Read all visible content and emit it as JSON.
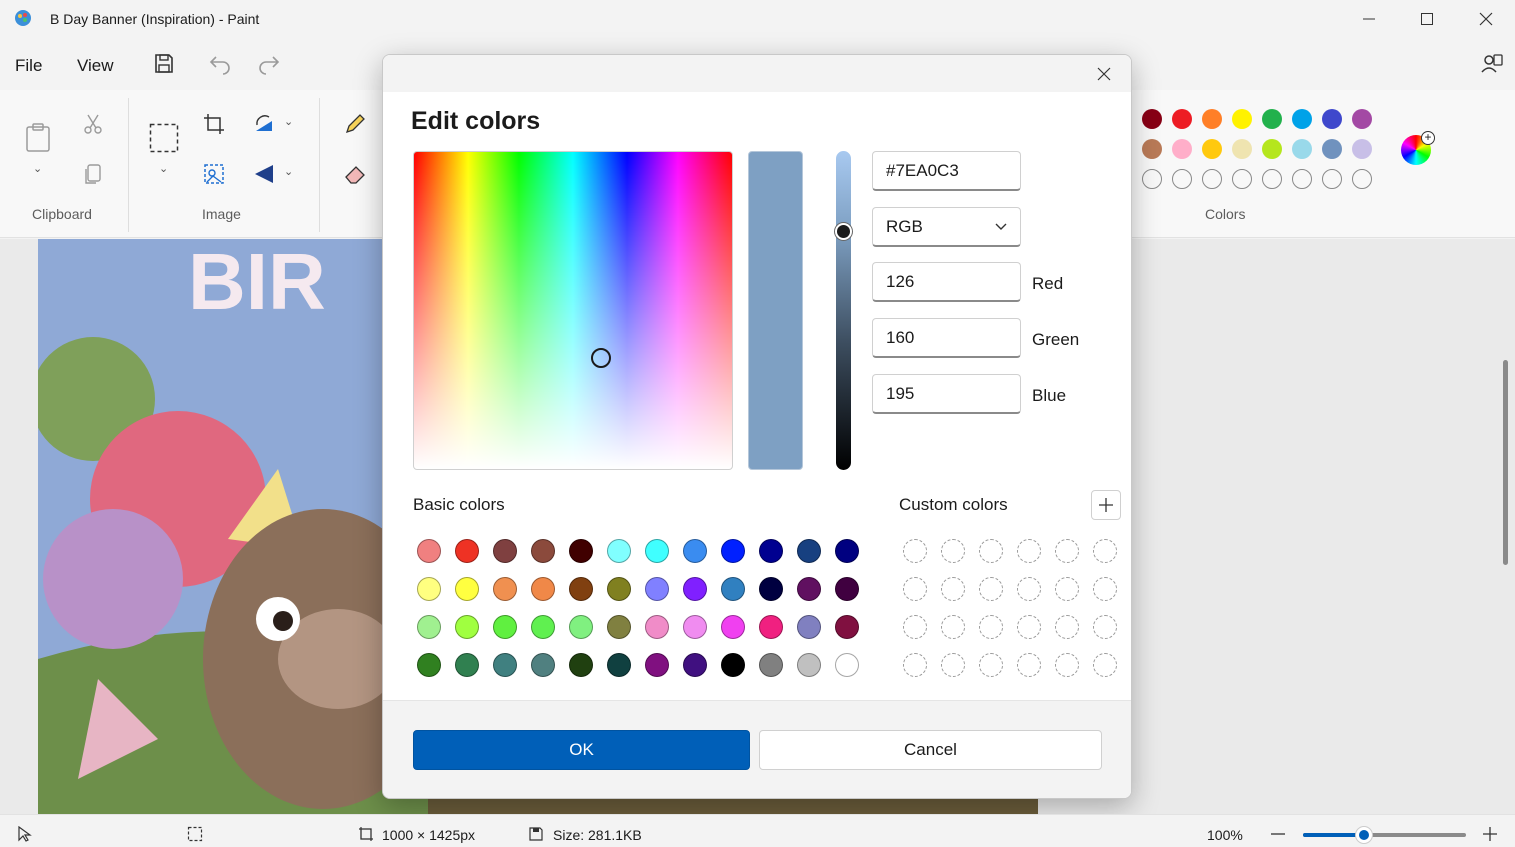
{
  "window": {
    "title": "B Day Banner (Inspiration) - Paint"
  },
  "menu": {
    "file": "File",
    "view": "View"
  },
  "ribbon": {
    "groups": {
      "clipboard": "Clipboard",
      "image": "Image",
      "colors": "Colors"
    },
    "palette_row1": [
      "#880015",
      "#ed1c24",
      "#ff7f27",
      "#fff200",
      "#22b14c",
      "#00a2e8",
      "#3f48cc",
      "#a349a4"
    ],
    "palette_row2": [
      "#b97a57",
      "#ffaec9",
      "#ffc90e",
      "#efe4b0",
      "#b5e61d",
      "#99d9ea",
      "#7092be",
      "#c8bfe7"
    ],
    "palette_row3_empty_count": 8
  },
  "dialog": {
    "title": "Edit colors",
    "hex_value": "#7EA0C3",
    "mode": "RGB",
    "red": {
      "value": "126",
      "label": "Red"
    },
    "green": {
      "value": "160",
      "label": "Green"
    },
    "blue": {
      "value": "195",
      "label": "Blue"
    },
    "preview_color": "#7EA0C3",
    "basic_colors_label": "Basic colors",
    "custom_colors_label": "Custom colors",
    "basic_colors": [
      [
        "#f08080",
        "#ee3224",
        "#7f4040",
        "#8b4a3c",
        "#400000",
        "#80ffff",
        "#40ffff",
        "#3a8cf0",
        "#0020ff",
        "#000090",
        "#174080",
        "#000080"
      ],
      [
        "#ffff80",
        "#ffff40",
        "#f09050",
        "#f08848",
        "#804010",
        "#808020",
        "#8080ff",
        "#8020ff",
        "#3080c0",
        "#000040",
        "#601060",
        "#400040"
      ],
      [
        "#a0f090",
        "#a0ff40",
        "#60f040",
        "#60f050",
        "#80f080",
        "#808040",
        "#f08cc8",
        "#f08cf0",
        "#f040f0",
        "#f02080",
        "#8080c0",
        "#801040"
      ],
      [
        "#308020",
        "#308050",
        "#408080",
        "#508080",
        "#204010",
        "#104040",
        "#801080",
        "#401080",
        "#000000",
        "#808080",
        "#c0c0c0",
        "#ffffff"
      ]
    ],
    "custom_rows": 4,
    "custom_cols": 6,
    "ok_label": "OK",
    "cancel_label": "Cancel"
  },
  "status": {
    "dimensions": "1000 × 1425px",
    "size": "Size: 281.1KB",
    "zoom": "100%",
    "zoom_level": 0.4
  }
}
